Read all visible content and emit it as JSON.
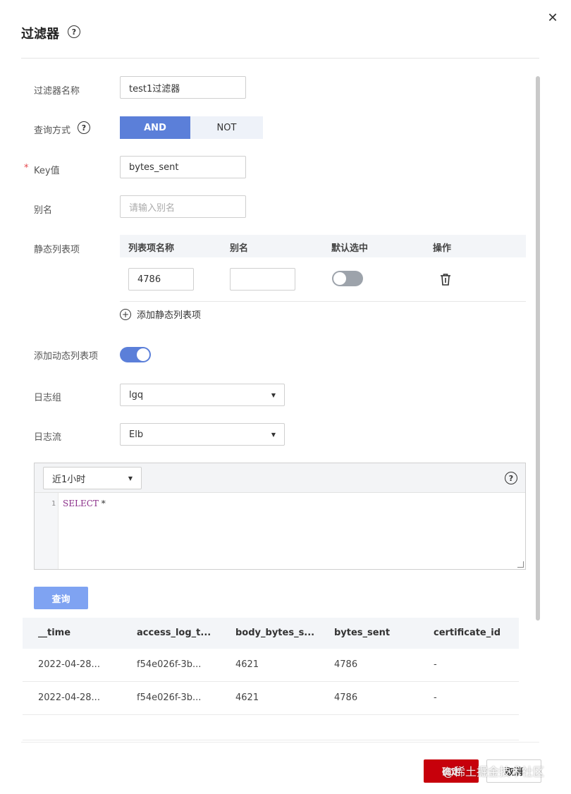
{
  "dialog": {
    "title": "过滤器",
    "help_icon": "question-circle-icon",
    "close_icon": "close-icon",
    "close_glyph": "✕"
  },
  "form": {
    "filter_name": {
      "label": "过滤器名称",
      "value": "test1过滤器"
    },
    "query_mode": {
      "label": "查询方式",
      "options": [
        "AND",
        "NOT"
      ],
      "selected": "AND"
    },
    "key": {
      "label": "Key值",
      "required_mark": "*",
      "value": "bytes_sent"
    },
    "alias": {
      "label": "别名",
      "placeholder": "请输入别名"
    },
    "static_list": {
      "label": "静态列表项",
      "headers": [
        "列表项名称",
        "别名",
        "默认选中",
        "操作"
      ],
      "rows": [
        {
          "name": "4786",
          "alias": "",
          "default_selected": false
        }
      ],
      "delete_icon": "trash-icon",
      "add_label": "添加静态列表项",
      "add_icon": "plus-circle-icon",
      "add_glyph": "+"
    },
    "dynamic_list": {
      "label": "添加动态列表项",
      "enabled": true
    },
    "log_group": {
      "label": "日志组",
      "value": "lgq"
    },
    "log_stream": {
      "label": "日志流",
      "value": "Elb"
    }
  },
  "editor": {
    "time_range": "近1小时",
    "line_number": "1",
    "keyword": "SELECT",
    "rest": " *",
    "help_icon": "question-circle-icon"
  },
  "query_button": "查询",
  "results": {
    "columns": [
      "__time",
      "access_log_t...",
      "body_bytes_s...",
      "bytes_sent",
      "certificate_id"
    ],
    "rows": [
      [
        "2022-04-28...",
        "f54e026f-3b...",
        "4621",
        "4786",
        "-"
      ],
      [
        "2022-04-28...",
        "f54e026f-3b...",
        "4621",
        "4786",
        "-"
      ]
    ]
  },
  "footer": {
    "ok": "确定",
    "cancel": "取消",
    "watermark": "@稀土掘金技术社区"
  },
  "colors": {
    "primary": "#5b7fd9",
    "query_button": "#7fa3f2",
    "confirm": "#c7000b"
  }
}
